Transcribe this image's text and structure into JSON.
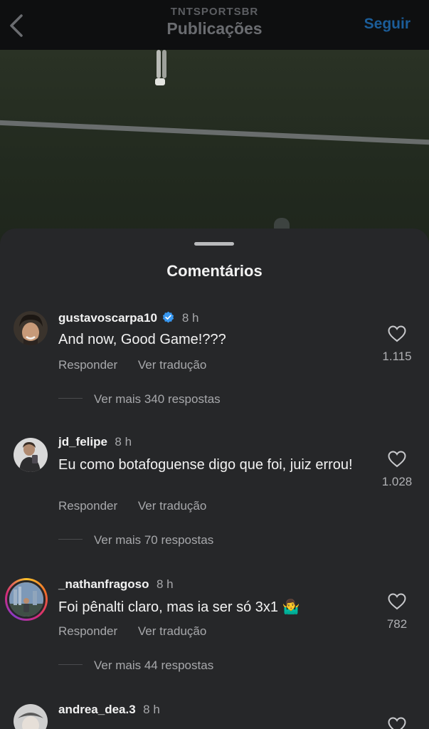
{
  "header": {
    "account": "TNTSPORTSBR",
    "title": "Publicações",
    "follow_label": "Seguir"
  },
  "sheet": {
    "title": "Comentários"
  },
  "comments": [
    {
      "username": "gustavoscarpa10",
      "verified": true,
      "time": "8 h",
      "text": "And now, Good Game!???",
      "reply_label": "Responder",
      "translate_label": "Ver tradução",
      "likes": "1.115",
      "more_replies": "Ver mais 340 respostas"
    },
    {
      "username": "jd_felipe",
      "verified": false,
      "time": "8 h",
      "text": "Eu como botafoguense digo que foi, juiz errou!",
      "reply_label": "Responder",
      "translate_label": "Ver tradução",
      "likes": "1.028",
      "more_replies": "Ver mais 70 respostas"
    },
    {
      "username": "_nathanfragoso",
      "verified": false,
      "time": "8 h",
      "text": "Foi pênalti claro, mas ia ser só 3x1 🤷‍♂️",
      "reply_label": "Responder",
      "translate_label": "Ver tradução",
      "likes": "782",
      "more_replies": "Ver mais 44 respostas"
    },
    {
      "username": "andrea_dea.3",
      "verified": false,
      "time": "8 h"
    }
  ],
  "colors": {
    "sheet_bg": "#262729",
    "text_primary": "#f2f2f2",
    "text_secondary": "#a7a8ab",
    "verified_blue": "#3897f0",
    "follow_blue": "#1b5d99"
  }
}
